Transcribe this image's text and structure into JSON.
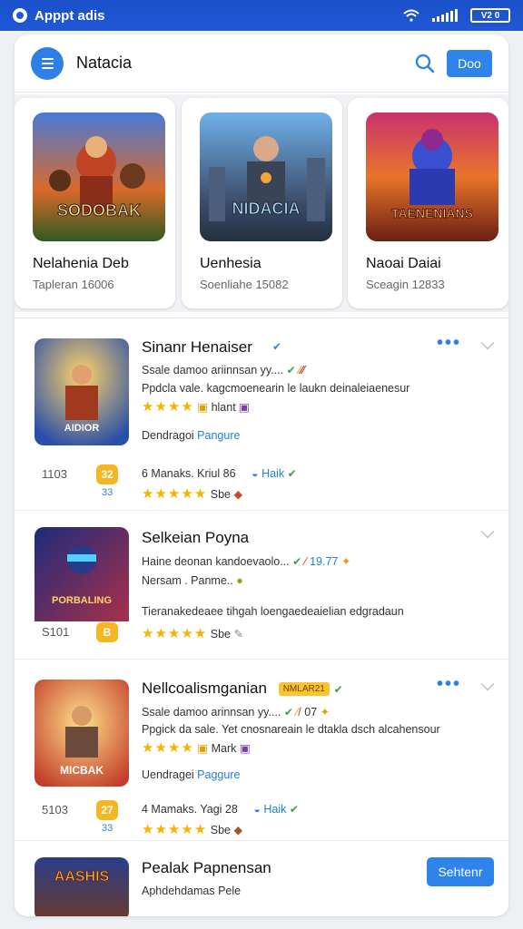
{
  "status_bar": {
    "app_name": "Apppt adis",
    "battery": "V2 0"
  },
  "header": {
    "title": "Natacia",
    "done_label": "Doo"
  },
  "featured": [
    {
      "title": "Nelahenia Deb",
      "subtitle": "Tapleran 16006",
      "art_text": "SODOBAK"
    },
    {
      "title": "Uenhesia",
      "subtitle": "Soenliahe 15082",
      "art_text": "NIDACIA"
    },
    {
      "title": "Naoai Daiai",
      "subtitle": "Sceagin 12833",
      "art_text": "TAENENIANS"
    }
  ],
  "list": [
    {
      "name": "Sinanr Henaiser",
      "line1": "Ssale damoo ariinnsan yy....",
      "line2": "Ppdcla vale. kagcmoenearin le laukn deinaleiaenesur",
      "rating_text": "hlant",
      "link": "Pangure",
      "link_prefix": "Dendragoi",
      "stat_num": "1103",
      "badge": "32",
      "badge_sub": "33",
      "meta": "6 Manaks. Kriul 86",
      "meta_link": "Haik",
      "meta2": "Sbe",
      "art_text": "AIDIOR"
    },
    {
      "name": "Selkeian Poyna",
      "line1": "Haine deonan kandoevaolo...",
      "line1_suffix": "19.77",
      "line2": "Nersam . Panme..",
      "line3": "Tieranakedeaee tihgah loengaedeaielian edgradaun",
      "stat_num": "S101",
      "badge": "B",
      "meta2": "Sbe",
      "art_text": "PORBALING"
    },
    {
      "name": "Nellcoalismganian",
      "tag": "NMLAR21",
      "line1": "Ssale damoo arinnsan yy....",
      "line1_suffix": "07",
      "line2": "Ppgick da sale. Yet cnosnareain le dtakla dsch alcahensour",
      "rating_text": "Mark",
      "link": "Paggure",
      "link_prefix": "Uendragei",
      "stat_num": "5103",
      "badge": "27",
      "badge_sub": "33",
      "meta": "4 Mamaks. Yagi 28",
      "meta_link": "Haik",
      "meta2": "Sbe",
      "art_text": "MICBAK"
    },
    {
      "name": "Pealak Papnensan",
      "line1": "Aphdehdamas Pele",
      "button": "Sehtenr",
      "art_text": "AASHIS"
    }
  ],
  "colors": {
    "accent": "#2f84ec",
    "status_bar": "#1d53cf",
    "star": "#f4b400",
    "badge": "#f6b522"
  }
}
